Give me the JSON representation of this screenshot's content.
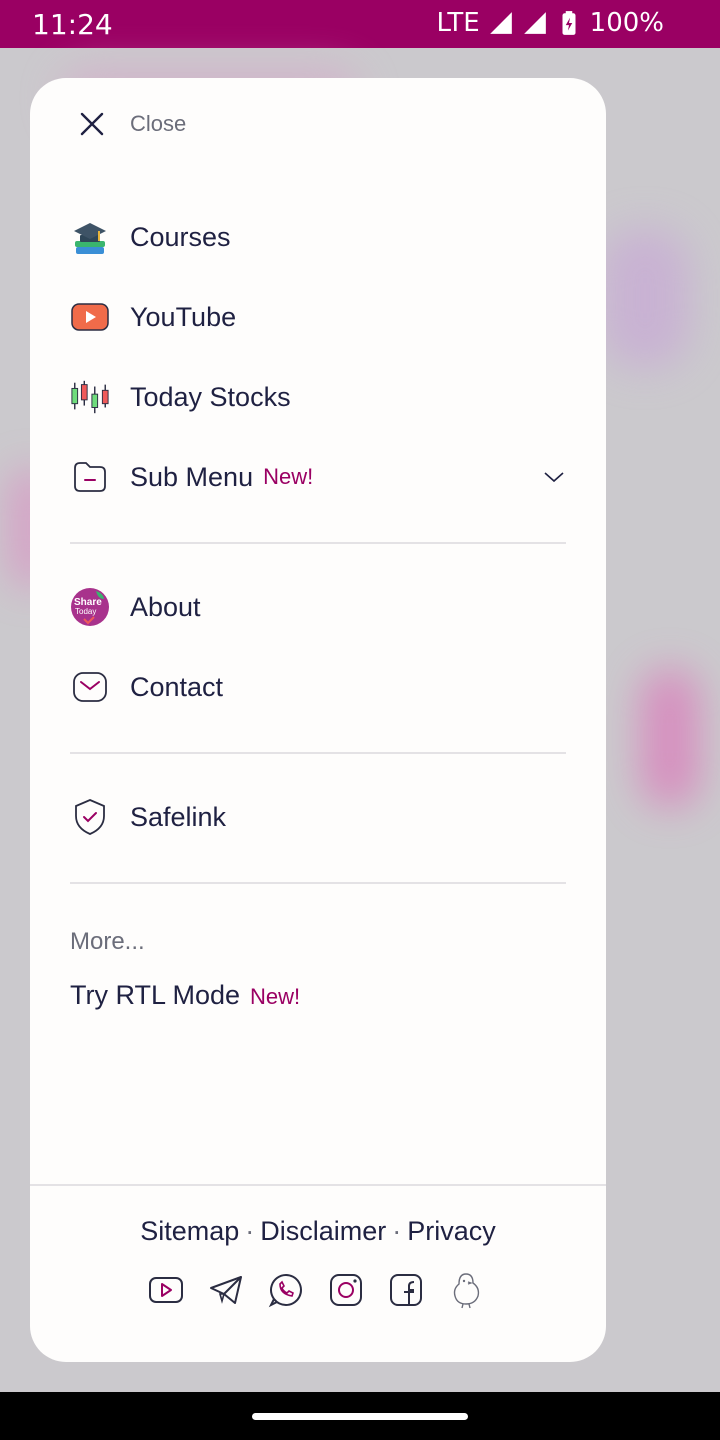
{
  "status_bar": {
    "time": "11:24",
    "network": "LTE",
    "battery": "100%"
  },
  "menu": {
    "close_label": "Close",
    "items": [
      {
        "label": "Courses",
        "icon": "graduation-cap-books-icon"
      },
      {
        "label": "YouTube",
        "icon": "youtube-icon"
      },
      {
        "label": "Today Stocks",
        "icon": "candlestick-chart-icon"
      },
      {
        "label": "Sub Menu",
        "icon": "folder-icon",
        "badge": "New!"
      }
    ],
    "secondary": [
      {
        "label": "About",
        "icon": "share-today-logo"
      },
      {
        "label": "Contact",
        "icon": "mail-icon"
      }
    ],
    "tertiary": [
      {
        "label": "Safelink",
        "icon": "shield-check-icon"
      }
    ],
    "more_label": "More...",
    "rtl": {
      "label": "Try RTL Mode",
      "badge": "New!"
    }
  },
  "footer": {
    "links": [
      "Sitemap",
      "Disclaimer",
      "Privacy"
    ],
    "separator": "·",
    "socials": [
      "youtube-icon",
      "telegram-icon",
      "whatsapp-icon",
      "instagram-icon",
      "facebook-icon",
      "chick-icon"
    ]
  },
  "logo_text": [
    "Share",
    "Today"
  ],
  "colors": {
    "accent": "#9a0063",
    "text": "#1f2142",
    "muted": "#6b6d7a"
  }
}
